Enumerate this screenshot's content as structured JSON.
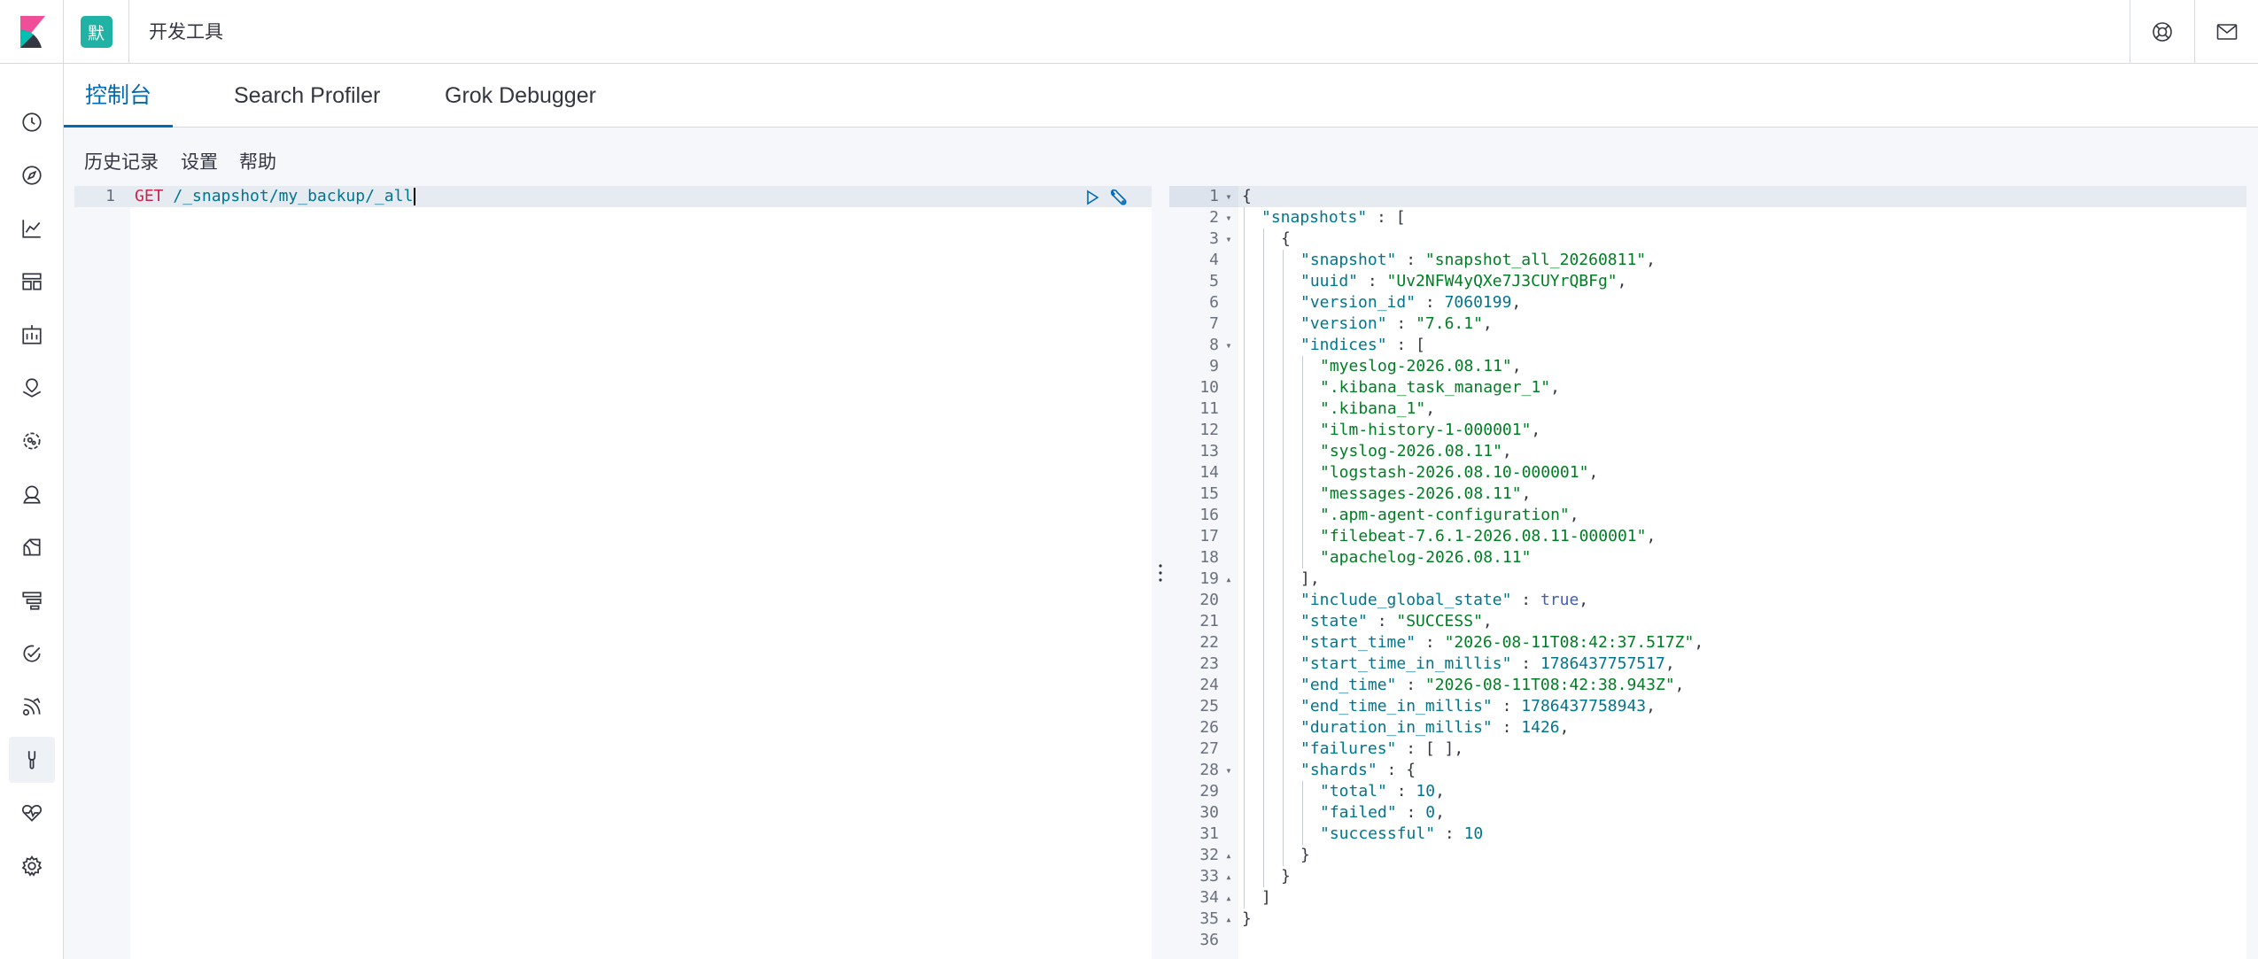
{
  "header": {
    "space_initial": "默",
    "app_title": "开发工具",
    "icons": [
      "kibana-logo-icon",
      "help-icon",
      "mail-icon"
    ]
  },
  "sidenav": {
    "items": [
      {
        "name": "recently-viewed-icon",
        "label": "Recently viewed"
      },
      {
        "name": "discover-icon",
        "label": "Discover"
      },
      {
        "name": "visualize-icon",
        "label": "Visualize"
      },
      {
        "name": "dashboard-icon",
        "label": "Dashboard"
      },
      {
        "name": "canvas-icon",
        "label": "Canvas"
      },
      {
        "name": "maps-icon",
        "label": "Maps"
      },
      {
        "name": "machine-learning-icon",
        "label": "Machine Learning"
      },
      {
        "name": "infrastructure-icon",
        "label": "Infrastructure"
      },
      {
        "name": "logs-icon",
        "label": "Logs"
      },
      {
        "name": "apm-icon",
        "label": "APM"
      },
      {
        "name": "uptime-icon",
        "label": "Uptime"
      },
      {
        "name": "siem-icon",
        "label": "SIEM"
      },
      {
        "name": "dev-tools-icon",
        "label": "Dev Tools"
      },
      {
        "name": "stack-monitoring-icon",
        "label": "Stack Monitoring"
      },
      {
        "name": "management-icon",
        "label": "Management"
      }
    ]
  },
  "tabs": [
    {
      "label": "控制台",
      "active": true
    },
    {
      "label": "Search Profiler",
      "active": false
    },
    {
      "label": "Grok Debugger",
      "active": false
    }
  ],
  "menu": {
    "history": "历史记录",
    "settings": "设置",
    "help": "帮助"
  },
  "request": {
    "line_number": "1",
    "method": "GET",
    "url": "/_snapshot/my_backup/_all",
    "actions": [
      "play-icon",
      "wrench-icon"
    ]
  },
  "response": {
    "lines": [
      {
        "n": "1",
        "fold": "▾",
        "indent": 0,
        "t": [
          [
            "p",
            "{"
          ]
        ]
      },
      {
        "n": "2",
        "fold": "▾",
        "indent": 1,
        "t": [
          [
            "k",
            "\"snapshots\""
          ],
          [
            "p",
            " : ["
          ]
        ]
      },
      {
        "n": "3",
        "fold": "▾",
        "indent": 2,
        "t": [
          [
            "p",
            "{"
          ]
        ]
      },
      {
        "n": "4",
        "fold": "",
        "indent": 3,
        "t": [
          [
            "k",
            "\"snapshot\""
          ],
          [
            "p",
            " : "
          ],
          [
            "s",
            "\"snapshot_all_20260811\""
          ],
          [
            "p",
            ","
          ]
        ]
      },
      {
        "n": "5",
        "fold": "",
        "indent": 3,
        "t": [
          [
            "k",
            "\"uuid\""
          ],
          [
            "p",
            " : "
          ],
          [
            "s",
            "\"Uv2NFW4yQXe7J3CUYrQBFg\""
          ],
          [
            "p",
            ","
          ]
        ]
      },
      {
        "n": "6",
        "fold": "",
        "indent": 3,
        "t": [
          [
            "k",
            "\"version_id\""
          ],
          [
            "p",
            " : "
          ],
          [
            "n",
            "7060199"
          ],
          [
            "p",
            ","
          ]
        ]
      },
      {
        "n": "7",
        "fold": "",
        "indent": 3,
        "t": [
          [
            "k",
            "\"version\""
          ],
          [
            "p",
            " : "
          ],
          [
            "s",
            "\"7.6.1\""
          ],
          [
            "p",
            ","
          ]
        ]
      },
      {
        "n": "8",
        "fold": "▾",
        "indent": 3,
        "t": [
          [
            "k",
            "\"indices\""
          ],
          [
            "p",
            " : ["
          ]
        ]
      },
      {
        "n": "9",
        "fold": "",
        "indent": 4,
        "t": [
          [
            "s",
            "\"myeslog-2026.08.11\""
          ],
          [
            "p",
            ","
          ]
        ]
      },
      {
        "n": "10",
        "fold": "",
        "indent": 4,
        "t": [
          [
            "s",
            "\".kibana_task_manager_1\""
          ],
          [
            "p",
            ","
          ]
        ]
      },
      {
        "n": "11",
        "fold": "",
        "indent": 4,
        "t": [
          [
            "s",
            "\".kibana_1\""
          ],
          [
            "p",
            ","
          ]
        ]
      },
      {
        "n": "12",
        "fold": "",
        "indent": 4,
        "t": [
          [
            "s",
            "\"ilm-history-1-000001\""
          ],
          [
            "p",
            ","
          ]
        ]
      },
      {
        "n": "13",
        "fold": "",
        "indent": 4,
        "t": [
          [
            "s",
            "\"syslog-2026.08.11\""
          ],
          [
            "p",
            ","
          ]
        ]
      },
      {
        "n": "14",
        "fold": "",
        "indent": 4,
        "t": [
          [
            "s",
            "\"logstash-2026.08.10-000001\""
          ],
          [
            "p",
            ","
          ]
        ]
      },
      {
        "n": "15",
        "fold": "",
        "indent": 4,
        "t": [
          [
            "s",
            "\"messages-2026.08.11\""
          ],
          [
            "p",
            ","
          ]
        ]
      },
      {
        "n": "16",
        "fold": "",
        "indent": 4,
        "t": [
          [
            "s",
            "\".apm-agent-configuration\""
          ],
          [
            "p",
            ","
          ]
        ]
      },
      {
        "n": "17",
        "fold": "",
        "indent": 4,
        "t": [
          [
            "s",
            "\"filebeat-7.6.1-2026.08.11-000001\""
          ],
          [
            "p",
            ","
          ]
        ]
      },
      {
        "n": "18",
        "fold": "",
        "indent": 4,
        "t": [
          [
            "s",
            "\"apachelog-2026.08.11\""
          ]
        ]
      },
      {
        "n": "19",
        "fold": "▴",
        "indent": 3,
        "t": [
          [
            "p",
            "],"
          ]
        ]
      },
      {
        "n": "20",
        "fold": "",
        "indent": 3,
        "t": [
          [
            "k",
            "\"include_global_state\""
          ],
          [
            "p",
            " : "
          ],
          [
            "b",
            "true"
          ],
          [
            "p",
            ","
          ]
        ]
      },
      {
        "n": "21",
        "fold": "",
        "indent": 3,
        "t": [
          [
            "k",
            "\"state\""
          ],
          [
            "p",
            " : "
          ],
          [
            "s",
            "\"SUCCESS\""
          ],
          [
            "p",
            ","
          ]
        ]
      },
      {
        "n": "22",
        "fold": "",
        "indent": 3,
        "t": [
          [
            "k",
            "\"start_time\""
          ],
          [
            "p",
            " : "
          ],
          [
            "s",
            "\"2026-08-11T08:42:37.517Z\""
          ],
          [
            "p",
            ","
          ]
        ]
      },
      {
        "n": "23",
        "fold": "",
        "indent": 3,
        "t": [
          [
            "k",
            "\"start_time_in_millis\""
          ],
          [
            "p",
            " : "
          ],
          [
            "n",
            "1786437757517"
          ],
          [
            "p",
            ","
          ]
        ]
      },
      {
        "n": "24",
        "fold": "",
        "indent": 3,
        "t": [
          [
            "k",
            "\"end_time\""
          ],
          [
            "p",
            " : "
          ],
          [
            "s",
            "\"2026-08-11T08:42:38.943Z\""
          ],
          [
            "p",
            ","
          ]
        ]
      },
      {
        "n": "25",
        "fold": "",
        "indent": 3,
        "t": [
          [
            "k",
            "\"end_time_in_millis\""
          ],
          [
            "p",
            " : "
          ],
          [
            "n",
            "1786437758943"
          ],
          [
            "p",
            ","
          ]
        ]
      },
      {
        "n": "26",
        "fold": "",
        "indent": 3,
        "t": [
          [
            "k",
            "\"duration_in_millis\""
          ],
          [
            "p",
            " : "
          ],
          [
            "n",
            "1426"
          ],
          [
            "p",
            ","
          ]
        ]
      },
      {
        "n": "27",
        "fold": "",
        "indent": 3,
        "t": [
          [
            "k",
            "\"failures\""
          ],
          [
            "p",
            " : [ ],"
          ]
        ]
      },
      {
        "n": "28",
        "fold": "▾",
        "indent": 3,
        "t": [
          [
            "k",
            "\"shards\""
          ],
          [
            "p",
            " : {"
          ]
        ]
      },
      {
        "n": "29",
        "fold": "",
        "indent": 4,
        "t": [
          [
            "k",
            "\"total\""
          ],
          [
            "p",
            " : "
          ],
          [
            "n",
            "10"
          ],
          [
            "p",
            ","
          ]
        ]
      },
      {
        "n": "30",
        "fold": "",
        "indent": 4,
        "t": [
          [
            "k",
            "\"failed\""
          ],
          [
            "p",
            " : "
          ],
          [
            "n",
            "0"
          ],
          [
            "p",
            ","
          ]
        ]
      },
      {
        "n": "31",
        "fold": "",
        "indent": 4,
        "t": [
          [
            "k",
            "\"successful\""
          ],
          [
            "p",
            " : "
          ],
          [
            "n",
            "10"
          ]
        ]
      },
      {
        "n": "32",
        "fold": "▴",
        "indent": 3,
        "t": [
          [
            "p",
            "}"
          ]
        ]
      },
      {
        "n": "33",
        "fold": "▴",
        "indent": 2,
        "t": [
          [
            "p",
            "}"
          ]
        ]
      },
      {
        "n": "34",
        "fold": "▴",
        "indent": 1,
        "t": [
          [
            "p",
            "]"
          ]
        ]
      },
      {
        "n": "35",
        "fold": "▴",
        "indent": 0,
        "t": [
          [
            "p",
            "}"
          ]
        ]
      },
      {
        "n": "36",
        "fold": "",
        "indent": 0,
        "t": []
      }
    ]
  },
  "colors": {
    "accent": "#006bb4",
    "space_avatar": "#20b2a4",
    "key": "#00758f",
    "string": "#017d24",
    "boolean": "#3f5cbf",
    "method": "#c7254e"
  }
}
